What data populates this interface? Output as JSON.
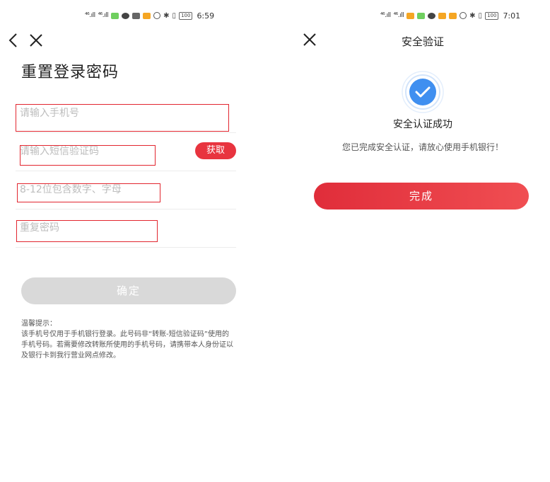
{
  "left": {
    "status": {
      "signal1": "⁴⁶.ıll",
      "signal2": "⁴⁶.ıll",
      "battery": "100",
      "time": "6:59"
    },
    "title": "重置登录密码",
    "fields": {
      "phone_placeholder": "请输入手机号",
      "sms_placeholder": "请输入短信验证码",
      "get_code_label": "获取",
      "password_placeholder": "8-12位包含数字、字母",
      "repeat_placeholder": "重复密码"
    },
    "confirm_label": "确定",
    "tips": {
      "title": "温馨提示：",
      "body": "该手机号仅用于手机银行登录。此号码非“转账-短信验证码”使用的手机号码。若需要修改转账所使用的手机号码，请携带本人身份证以及银行卡到我行营业网点修改。"
    }
  },
  "right": {
    "status": {
      "signal1": "⁴⁶.ıll",
      "signal2": "⁴⁶.ıll",
      "battery": "100",
      "time": "7:01"
    },
    "title": "安全验证",
    "success_title": "安全认证成功",
    "success_desc": "您已完成安全认证，请放心使用手机银行！",
    "done_label": "完成"
  },
  "colors": {
    "accent": "#e8343f",
    "highlight_box": "#e2262f",
    "disabled": "#d9d9d9",
    "check_blue": "#3f8ff0"
  },
  "icons": {
    "back": "chevron-left-icon",
    "close": "close-icon",
    "success": "check-circle-icon"
  }
}
